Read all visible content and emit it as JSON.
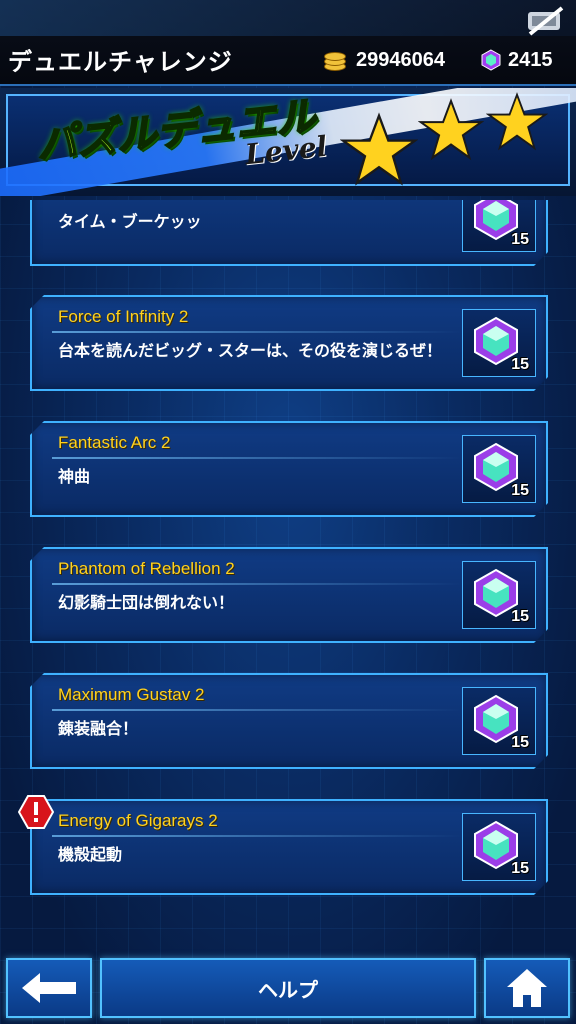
{
  "header": {
    "title": "デュエルチャレンジ",
    "gold": "29946064",
    "gems": "2415"
  },
  "banner": {
    "title": "パズルデュエル",
    "level_label": "Level",
    "stars": 3
  },
  "challenges": [
    {
      "name": "",
      "description": "タイム・ブーケッッ",
      "reward": "15",
      "partial": true
    },
    {
      "name": "Force of Infinity 2",
      "description": "台本を読んだビッグ・スターは、その役を演じるぜ！",
      "reward": "15"
    },
    {
      "name": "Fantastic Arc 2",
      "description": "神曲",
      "reward": "15"
    },
    {
      "name": "Phantom of Rebellion 2",
      "description": "幻影騎士団は倒れない！",
      "reward": "15"
    },
    {
      "name": "Maximum Gustav 2",
      "description": "錬装融合！",
      "reward": "15"
    },
    {
      "name": "Energy of Gigarays 2",
      "description": "機殻起動",
      "reward": "15",
      "alert": true
    }
  ],
  "footer": {
    "help_label": "ヘルプ"
  }
}
